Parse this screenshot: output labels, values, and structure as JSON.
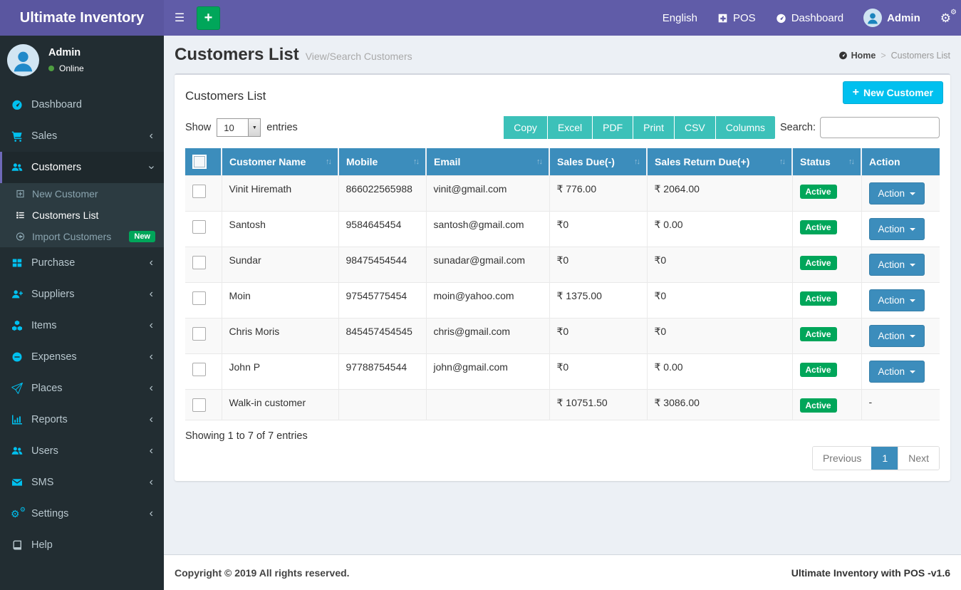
{
  "app": {
    "title": "Ultimate Inventory",
    "copyright": "Copyright © 2019 All rights reserved.",
    "version_label": "Ultimate Inventory with POS -v1.6"
  },
  "colors": {
    "navbar_purple": "#605ca8",
    "sidebar_dark": "#222d32",
    "table_header_blue": "#3c8dbc",
    "info_cyan": "#00c0ef",
    "success_green": "#00a65a",
    "export_teal": "#3cc1b9",
    "content_bg": "#ecf0f5",
    "sidebar_icon_blue": "#00c0ef"
  },
  "navbar": {
    "hamburger_icon": "hamburger-icon",
    "quick_add_icon": "plus-icon",
    "language": "English",
    "pos_label": "POS",
    "pos_icon": "plus-square-icon",
    "dashboard_label": "Dashboard",
    "dashboard_icon": "gauge-icon",
    "user_name": "Admin",
    "settings_icon": "cogs-icon"
  },
  "sidebar": {
    "user": {
      "name": "Admin",
      "status": "Online"
    },
    "items": [
      {
        "label": "Dashboard",
        "icon": "gauge-icon",
        "chevron": ""
      },
      {
        "label": "Sales",
        "icon": "cart-icon",
        "chevron": "left"
      },
      {
        "label": "Customers",
        "icon": "users-icon",
        "chevron": "down",
        "active": true
      },
      {
        "label": "Purchase",
        "icon": "grid-icon",
        "chevron": "left"
      },
      {
        "label": "Suppliers",
        "icon": "user-plus-icon",
        "chevron": "left"
      },
      {
        "label": "Items",
        "icon": "cubes-icon",
        "chevron": "left"
      },
      {
        "label": "Expenses",
        "icon": "minus-circle-icon",
        "chevron": "left"
      },
      {
        "label": "Places",
        "icon": "paper-plane-icon",
        "chevron": "left"
      },
      {
        "label": "Reports",
        "icon": "bar-chart-icon",
        "chevron": "left"
      },
      {
        "label": "Users",
        "icon": "users-icon",
        "chevron": "left"
      },
      {
        "label": "SMS",
        "icon": "envelope-icon",
        "chevron": "left"
      },
      {
        "label": "Settings",
        "icon": "cogs-icon",
        "chevron": "left"
      },
      {
        "label": "Help",
        "icon": "book-icon",
        "chevron": ""
      }
    ],
    "customers_submenu": [
      {
        "label": "New Customer",
        "icon": "plus-square-icon"
      },
      {
        "label": "Customers List",
        "icon": "list-icon",
        "active": true
      },
      {
        "label": "Import Customers",
        "icon": "arrow-circle-left-icon",
        "badge": "New"
      }
    ]
  },
  "page": {
    "title": "Customers List",
    "subtitle": "View/Search Customers",
    "breadcrumb": {
      "home": "Home",
      "separator": ">",
      "current": "Customers List"
    }
  },
  "card": {
    "title": "Customers List",
    "new_customer_label": "New Customer"
  },
  "controls": {
    "show_label": "Show",
    "page_length": "10",
    "entries_label": "entries",
    "export_buttons": [
      "Copy",
      "Excel",
      "PDF",
      "Print",
      "CSV",
      "Columns"
    ],
    "search_label": "Search:",
    "search_value": ""
  },
  "table": {
    "headers": [
      "Customer Name",
      "Mobile",
      "Email",
      "Sales Due(-)",
      "Sales Return Due(+)",
      "Status",
      "Action"
    ],
    "rows": [
      {
        "name": "Vinit Hiremath",
        "mobile": "866022565988",
        "email": "vinit@gmail.com",
        "sales_due": "₹ 776.00",
        "sales_return_due": "₹ 2064.00",
        "status": "Active",
        "action": "Action",
        "has_action": true
      },
      {
        "name": "Santosh",
        "mobile": "9584645454",
        "email": "santosh@gmail.com",
        "sales_due": "₹0",
        "sales_return_due": "₹ 0.00",
        "status": "Active",
        "action": "Action",
        "has_action": true
      },
      {
        "name": "Sundar",
        "mobile": "98475454544",
        "email": "sunadar@gmail.com",
        "sales_due": "₹0",
        "sales_return_due": "₹0",
        "status": "Active",
        "action": "Action",
        "has_action": true
      },
      {
        "name": "Moin",
        "mobile": "97545775454",
        "email": "moin@yahoo.com",
        "sales_due": "₹ 1375.00",
        "sales_return_due": "₹0",
        "status": "Active",
        "action": "Action",
        "has_action": true
      },
      {
        "name": "Chris Moris",
        "mobile": "845457454545",
        "email": "chris@gmail.com",
        "sales_due": "₹0",
        "sales_return_due": "₹0",
        "status": "Active",
        "action": "Action",
        "has_action": true
      },
      {
        "name": "John P",
        "mobile": "97788754544",
        "email": "john@gmail.com",
        "sales_due": "₹0",
        "sales_return_due": "₹ 0.00",
        "status": "Active",
        "action": "Action",
        "has_action": true
      },
      {
        "name": "Walk-in customer",
        "mobile": "",
        "email": "",
        "sales_due": "₹ 10751.50",
        "sales_return_due": "₹ 3086.00",
        "status": "Active",
        "action": "-",
        "has_action": false
      }
    ],
    "info": "Showing 1 to 7 of 7 entries",
    "pagination": {
      "previous": "Previous",
      "page": "1",
      "next": "Next"
    }
  }
}
